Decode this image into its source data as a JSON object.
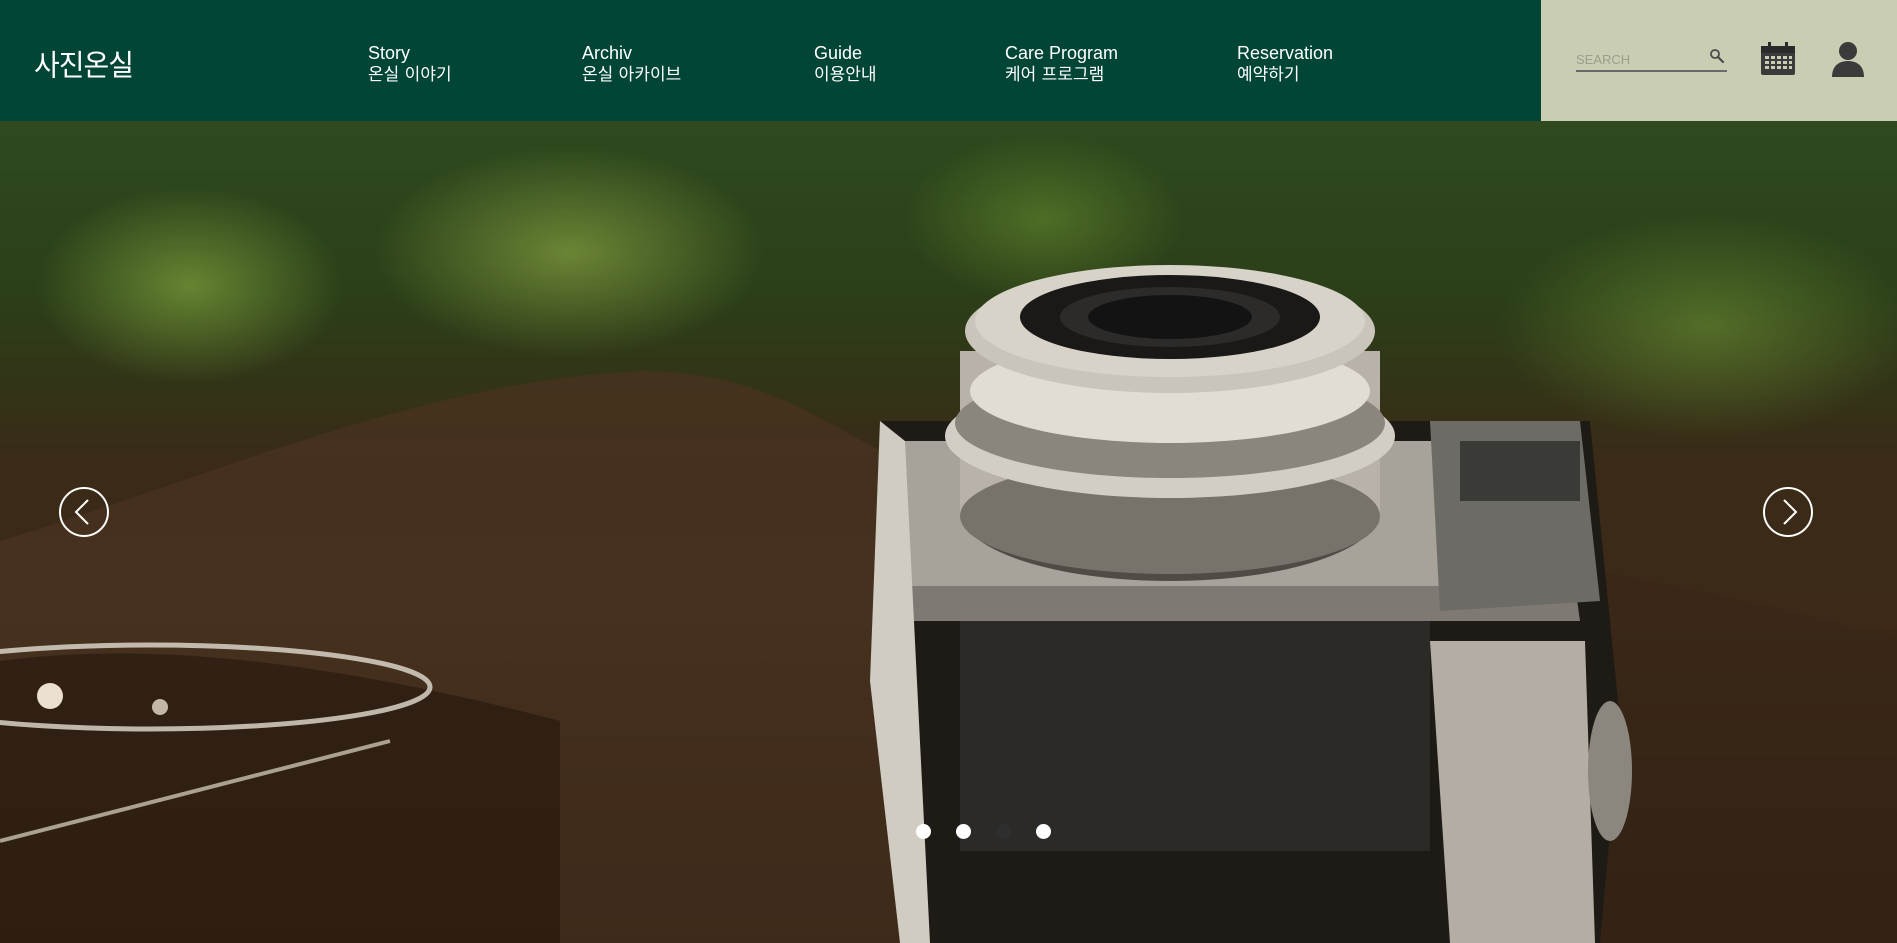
{
  "header": {
    "logo_text": "사진온실",
    "nav": [
      {
        "en": "Story",
        "ko": "온실 이야기"
      },
      {
        "en": "Archiv",
        "ko": "온실 아카이브"
      },
      {
        "en": "Guide",
        "ko": "이용안내"
      },
      {
        "en": "Care Program",
        "ko": "케어 프로그램"
      },
      {
        "en": "Reservation",
        "ko": "예약하기"
      }
    ],
    "search": {
      "placeholder": "SEARCH",
      "value": ""
    },
    "icons": [
      "search-icon",
      "calendar-icon",
      "user-icon"
    ]
  },
  "hero": {
    "image_description_icon": "vintage-camera-photo",
    "slides_total": 4,
    "active_slide": 3,
    "controls": {
      "prev_icon": "chevron-left-icon",
      "next_icon": "chevron-right-icon"
    }
  },
  "colors": {
    "header_bg": "#004536",
    "utility_bg": "#c9ceb2",
    "nav_text": "#ffffff",
    "dot_active": "#2e2e2e",
    "dot_inactive": "#ffffff"
  }
}
